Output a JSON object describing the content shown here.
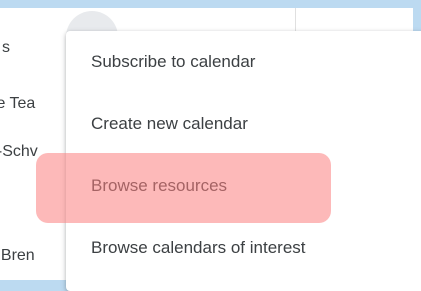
{
  "sidebar": {
    "items": [
      {
        "label": "s"
      },
      {
        "label": "te Tea"
      },
      {
        "label": "e-Schv"
      },
      {
        "label": "t Bren"
      }
    ]
  },
  "menu": {
    "items": [
      {
        "label": "Subscribe to calendar"
      },
      {
        "label": "Create new calendar"
      },
      {
        "label": "Browse resources"
      },
      {
        "label": "Browse calendars of interest"
      }
    ],
    "highlighted_index": 2
  },
  "colors": {
    "background": "#bcdaf1",
    "highlight": "#fc8080",
    "text": "#3c4043"
  }
}
